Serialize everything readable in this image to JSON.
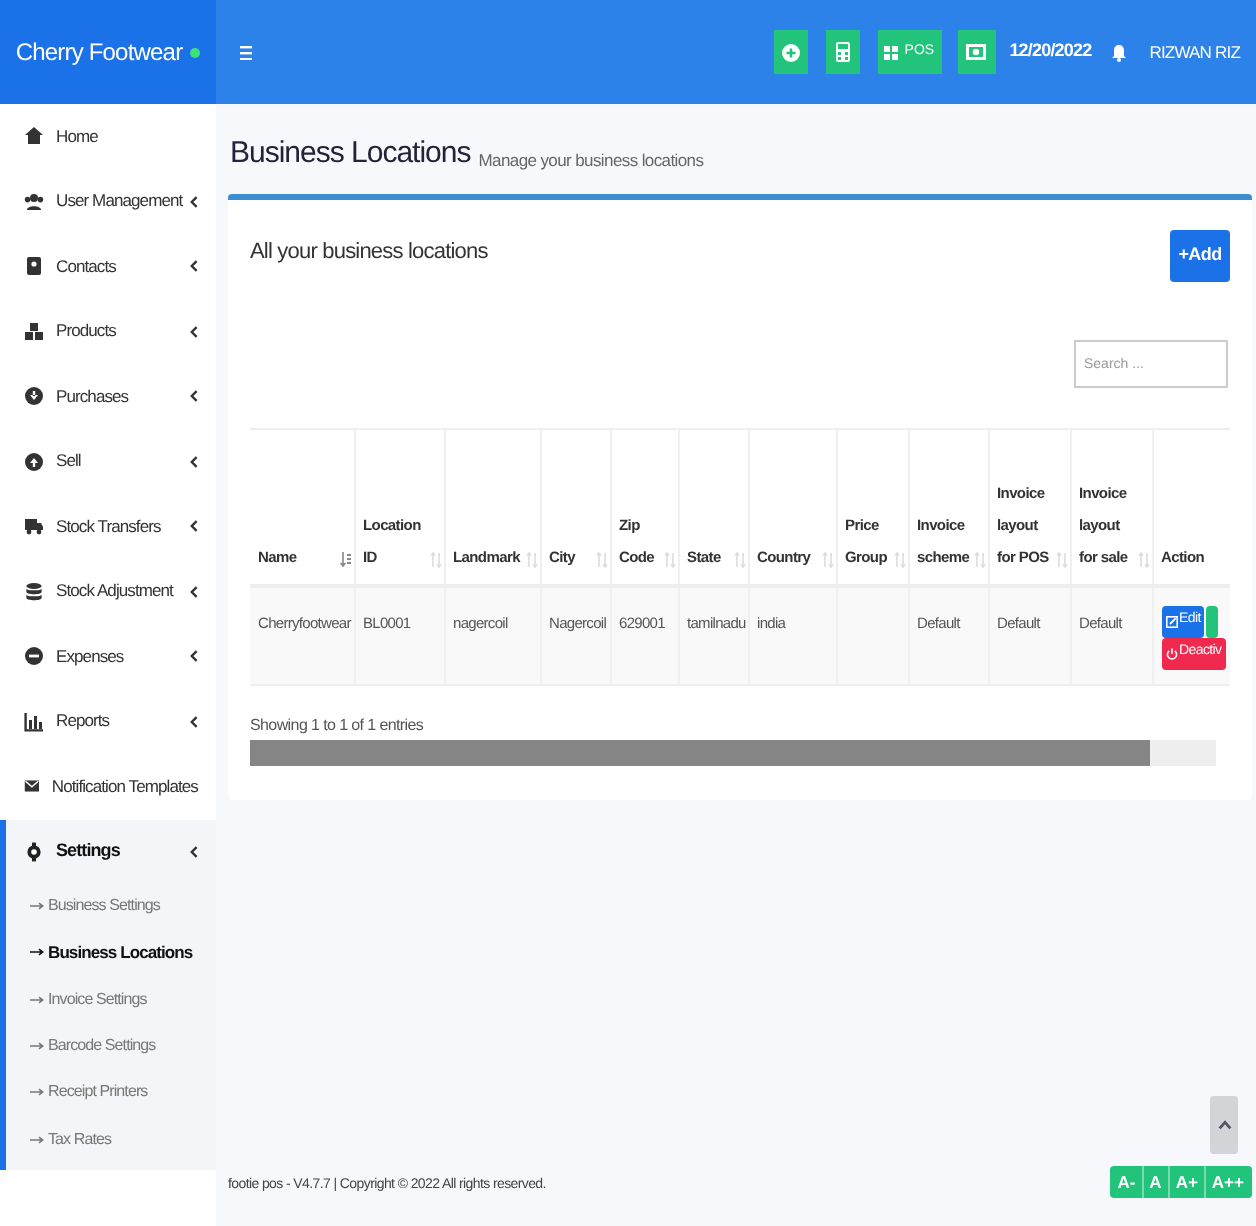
{
  "brand": {
    "name": "Cherry Footwear",
    "online": true
  },
  "header": {
    "pos_label": "POS",
    "date": "12/20/2022",
    "user": "RIZWAN RIZ"
  },
  "sidebar": {
    "items": [
      {
        "label": "Home",
        "has_submenu": false,
        "selected": false
      },
      {
        "label": "User Management",
        "has_submenu": true,
        "selected": false
      },
      {
        "label": "Contacts",
        "has_submenu": true,
        "selected": false
      },
      {
        "label": "Products",
        "has_submenu": true,
        "selected": false
      },
      {
        "label": "Purchases",
        "has_submenu": true,
        "selected": false
      },
      {
        "label": "Sell",
        "has_submenu": true,
        "selected": false
      },
      {
        "label": "Stock Transfers",
        "has_submenu": true,
        "selected": false
      },
      {
        "label": "Stock Adjustment",
        "has_submenu": true,
        "selected": false
      },
      {
        "label": "Expenses",
        "has_submenu": true,
        "selected": false
      },
      {
        "label": "Reports",
        "has_submenu": true,
        "selected": false
      },
      {
        "label": "Notification Templates",
        "has_submenu": false,
        "selected": false
      },
      {
        "label": "Settings",
        "has_submenu": true,
        "selected": true,
        "children": [
          {
            "label": "Business Settings",
            "selected": false
          },
          {
            "label": "Business Locations",
            "selected": true
          },
          {
            "label": "Invoice Settings",
            "selected": false
          },
          {
            "label": "Barcode Settings",
            "selected": false
          },
          {
            "label": "Receipt Printers",
            "selected": false
          },
          {
            "label": "Tax Rates",
            "selected": false
          }
        ]
      }
    ]
  },
  "page": {
    "title": "Business Locations",
    "subtitle": "Manage your business locations"
  },
  "card": {
    "title": "All your business locations",
    "add_button": "+Add",
    "search": {
      "placeholder": "Search ..."
    },
    "table": {
      "columns": [
        {
          "label": "Name",
          "sorted": true
        },
        {
          "label": "Location ID",
          "sorted": false
        },
        {
          "label": "Landmark",
          "sorted": false
        },
        {
          "label": "City",
          "sorted": false
        },
        {
          "label": "Zip Code",
          "sorted": false
        },
        {
          "label": "State",
          "sorted": false
        },
        {
          "label": "Country",
          "sorted": false
        },
        {
          "label": "Price Group",
          "sorted": false
        },
        {
          "label": "Invoice scheme",
          "sorted": false
        },
        {
          "label": "Invoice layout for POS",
          "sorted": false
        },
        {
          "label": "Invoice layout for sale",
          "sorted": false
        },
        {
          "label": "Action"
        }
      ],
      "rows": [
        {
          "cells": [
            "Cherryfootwear",
            "BL0001",
            "nagercoil",
            "Nagercoil",
            "629001",
            "tamilnadu",
            "india",
            "",
            "Default",
            "Default",
            "Default"
          ],
          "actions": [
            {
              "kind": "edit",
              "label": "Edit"
            },
            {
              "kind": "view"
            },
            {
              "kind": "deactivate",
              "label": "Deactiv"
            }
          ]
        }
      ]
    },
    "info": "Showing 1 to 1 of 1 entries"
  },
  "footer": {
    "text": "footie pos - V4.7.7 | Copyright © 2022 All rights reserved.",
    "font_buttons": [
      "A-",
      "A",
      "A+",
      "A++"
    ]
  }
}
